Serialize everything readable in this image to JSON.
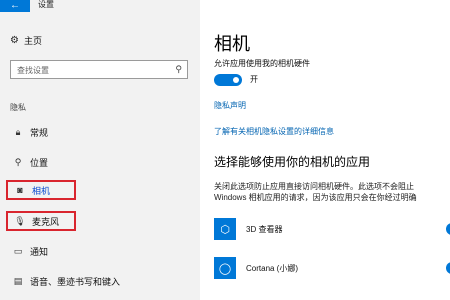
{
  "window": {
    "title": "设置",
    "back_glyph": "←"
  },
  "sidebar": {
    "home": {
      "icon": "gear-icon",
      "glyph": "⚙",
      "label": "主页"
    },
    "search": {
      "placeholder": "查找设置",
      "icon": "search-icon",
      "glyph": "⚲"
    },
    "section": "隐私",
    "items": [
      {
        "label": "常规",
        "icon": "lock-icon",
        "glyph": "🔒︎"
      },
      {
        "label": "位置",
        "icon": "location-icon",
        "glyph": "⚲"
      },
      {
        "label": "相机",
        "icon": "camera-icon",
        "glyph": "◙",
        "selected": true
      },
      {
        "label": "麦克风",
        "icon": "microphone-icon",
        "glyph": "🎙︎"
      },
      {
        "label": "通知",
        "icon": "notification-icon",
        "glyph": "▭"
      },
      {
        "label": "语音、墨迹书写和键入",
        "icon": "speech-icon",
        "glyph": "▤"
      }
    ]
  },
  "main": {
    "title": "相机",
    "allow_label": "允许应用使用我的相机硬件",
    "toggle_state": "开",
    "privacy_link": "隐私声明",
    "learn_link": "了解有关相机隐私设置的详细信息",
    "choose_heading": "选择能够使用你的相机的应用",
    "description_line1": "关闭此选项防止应用直接访问相机硬件。此选项不会阻止",
    "description_line2": "Windows 相机应用的请求，因为该应用只会在你经过明确",
    "apps": [
      {
        "name": "3D 查看器",
        "icon": "cube-icon",
        "glyph": "⬡"
      },
      {
        "name": "Cortana (小娜)",
        "icon": "cortana-icon",
        "glyph": "◯"
      }
    ]
  },
  "colors": {
    "accent": "#0078d7",
    "highlight": "#d9252e",
    "link": "#0063b1",
    "sidebar_bg": "#f2f2f2"
  }
}
